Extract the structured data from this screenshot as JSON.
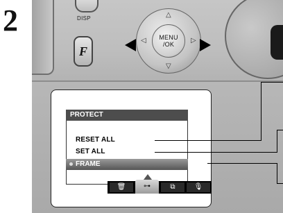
{
  "step": {
    "number": "2"
  },
  "camera": {
    "disp_label": "DISP",
    "f_button": "F",
    "menu_button": [
      "MENU",
      "/OK"
    ]
  },
  "menu": {
    "title": "PROTECT",
    "options": [
      "RESET ALL",
      "SET ALL",
      "FRAME"
    ],
    "selected": "FRAME",
    "tabs": [
      {
        "icon": "trash-icon",
        "glyph": "🗑"
      },
      {
        "icon": "key-icon",
        "glyph": "⊶"
      },
      {
        "icon": "copy-icon",
        "glyph": "⧉"
      },
      {
        "icon": "microphone-icon",
        "glyph": "🎙"
      }
    ],
    "active_tab": "key-icon"
  },
  "colors": {
    "arrow": "#000000",
    "menu_title_bg": "#4d4d4d",
    "selected_bg": "#666666"
  }
}
